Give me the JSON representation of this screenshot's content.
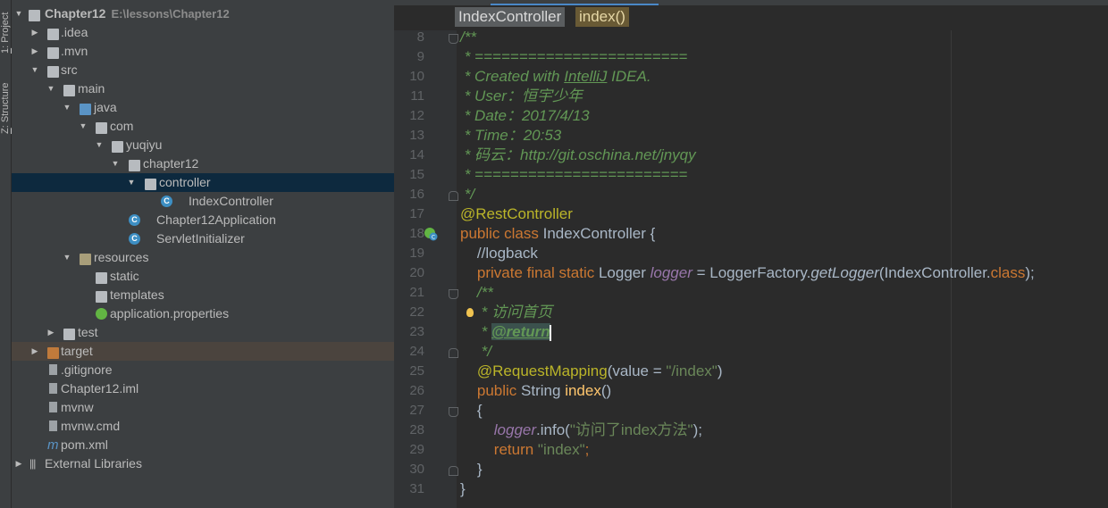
{
  "toolstrip": {
    "tab1_num": "1",
    "tab1_label": ": Project",
    "tab2_num": "Z",
    "tab2_label": ": Structure"
  },
  "project": {
    "root_name": "Chapter12",
    "root_path": "E:\\lessons\\Chapter12",
    "items": [
      {
        "label": "Chapter12"
      },
      {
        "label": ".idea"
      },
      {
        "label": ".mvn"
      },
      {
        "label": "src"
      },
      {
        "label": "main"
      },
      {
        "label": "java"
      },
      {
        "label": "com"
      },
      {
        "label": "yuqiyu"
      },
      {
        "label": "chapter12"
      },
      {
        "label": "controller"
      },
      {
        "label": "IndexController"
      },
      {
        "label": "Chapter12Application"
      },
      {
        "label": "ServletInitializer"
      },
      {
        "label": "resources"
      },
      {
        "label": "static"
      },
      {
        "label": "templates"
      },
      {
        "label": "application.properties"
      },
      {
        "label": "test"
      },
      {
        "label": "target"
      },
      {
        "label": ".gitignore"
      },
      {
        "label": "Chapter12.iml"
      },
      {
        "label": "mvnw"
      },
      {
        "label": "mvnw.cmd"
      },
      {
        "label": "pom.xml"
      },
      {
        "label": "External Libraries"
      }
    ]
  },
  "breadcrumb": {
    "class_name": "IndexController",
    "method_name": "index()"
  },
  "editor": {
    "line_numbers": [
      "8",
      "9",
      "10",
      "11",
      "12",
      "13",
      "14",
      "15",
      "16",
      "17",
      "18",
      "19",
      "20",
      "21",
      "22",
      "23",
      "24",
      "25",
      "26",
      "27",
      "28",
      "29",
      "30",
      "31"
    ]
  },
  "code": {
    "l8": "/**",
    "l9": " * ========================",
    "l10a": " * Created with ",
    "l10b": "IntelliJ",
    "l10c": " IDEA.",
    "l11": " * User：恒宇少年",
    "l12": " * Date：2017/4/13",
    "l13": " * Time：20:53",
    "l14": " * 码云：http://git.oschina.net/jnyqy",
    "l15": " * ========================",
    "l16": " */",
    "l17": "@RestController",
    "l18_kw": "public class ",
    "l18_rest": "IndexController {",
    "l19": "    //logback",
    "l20_kw": "    private final static ",
    "l20_type": "Logger ",
    "l20_field": "logger",
    "l20_eq": " = LoggerFactory.",
    "l20_method": "getLogger",
    "l20_arg": "(IndexController.",
    "l20_class": "class",
    "l20_end": ");",
    "l21": "    /**",
    "l22": "     * 访问首页",
    "l23a": "     * ",
    "l23tag": "@return",
    "l24": "     */",
    "l25_an": "    @RequestMapping",
    "l25_mid": "(value = ",
    "l25_str": "\"/index\"",
    "l25_end": ")",
    "l26_kw": "    public ",
    "l26_type": "String ",
    "l26_method": "index",
    "l26_end": "()",
    "l27": "    {",
    "l28_field": "        logger",
    "l28_call": ".info(",
    "l28_str": "\"访问了index方法\"",
    "l28_end": ");",
    "l29_kw": "        return ",
    "l29_str": "\"index\"",
    "l29_end": ";",
    "l30": "    }",
    "l31": "}"
  },
  "colors": {
    "background": "#2b2b2b",
    "panel": "#3c3f41",
    "selection": "#0d293e",
    "keyword": "#cc7832",
    "comment": "#629755",
    "string": "#6a8759",
    "annotation": "#bbb529"
  }
}
